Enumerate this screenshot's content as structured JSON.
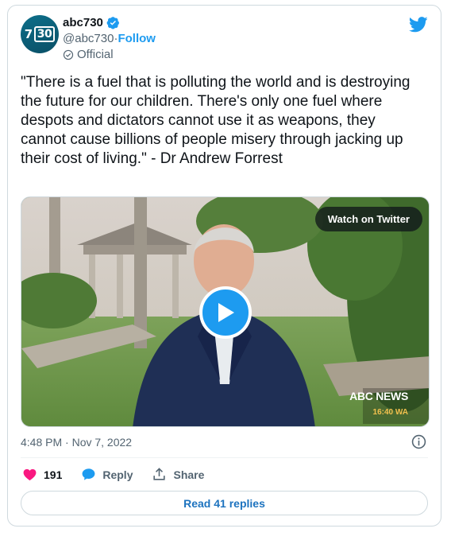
{
  "author": {
    "display_name": "abc730",
    "handle": "@abc730",
    "separator": " · ",
    "follow_label": "Follow",
    "official_label": "Official",
    "avatar_text_left": "7",
    "avatar_text_box": "30"
  },
  "tweet": {
    "text": "\"There is a fuel that is polluting the world and is destroying the future for our children. There's only one fuel where despots and dictators cannot use it as weapons, they cannot cause billions of people misery through jacking up their cost of living.\" - Dr Andrew Forrest",
    "timestamp": "4:48 PM · Nov 7, 2022"
  },
  "media": {
    "watch_label": "Watch on Twitter",
    "news_logo": "ABC NEWS",
    "news_time": "16:40 WA"
  },
  "actions": {
    "like_count": "191",
    "reply_label": "Reply",
    "share_label": "Share"
  },
  "replies_button": "Read 41 replies",
  "colors": {
    "accent": "#1d9bf0",
    "like": "#f91880",
    "muted": "#536471"
  }
}
